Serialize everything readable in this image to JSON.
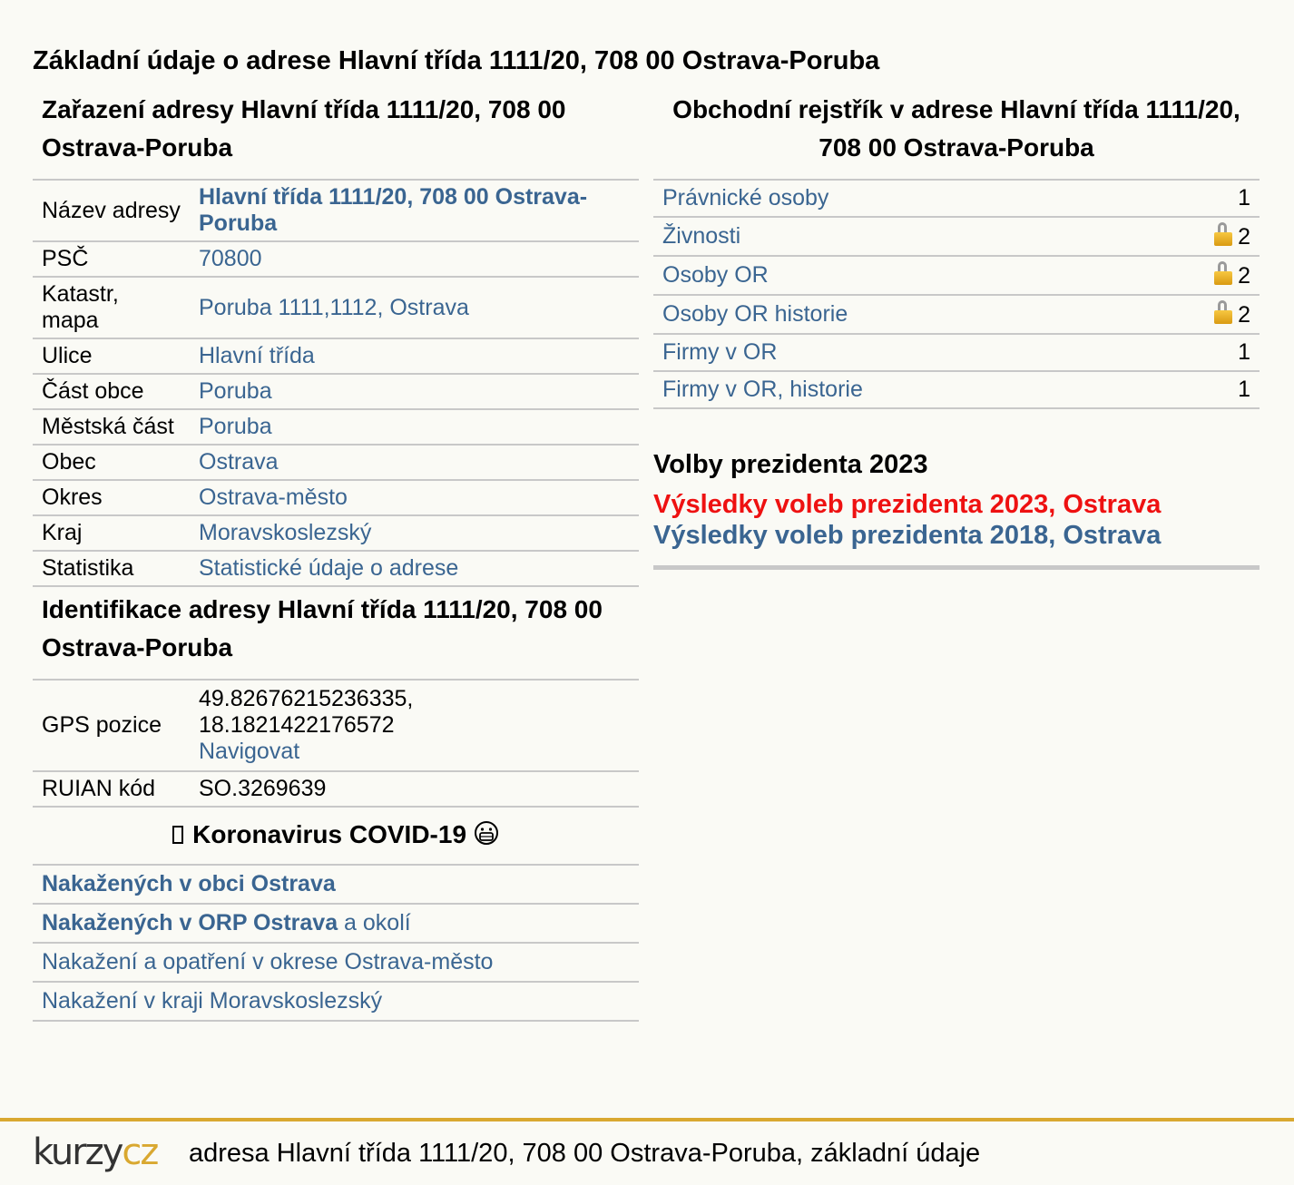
{
  "page_title": "Základní údaje o adrese Hlavní třída 1111/20, 708 00 Ostrava-Poruba",
  "zarazeni": {
    "title": "Zařazení adresy Hlavní třída 1111/20, 708 00 Ostrava-Poruba",
    "rows": [
      {
        "label": "Název adresy",
        "value": "Hlavní třída 1111/20, 708 00 Ostrava-Poruba"
      },
      {
        "label": "PSČ",
        "value": "70800"
      },
      {
        "label": "Katastr, mapa",
        "value": "Poruba 1111,1112, Ostrava"
      },
      {
        "label": "Ulice",
        "value": "Hlavní třída"
      },
      {
        "label": "Část obce",
        "value": "Poruba"
      },
      {
        "label": "Městská část",
        "value": "Poruba"
      },
      {
        "label": "Obec",
        "value": "Ostrava"
      },
      {
        "label": "Okres",
        "value": "Ostrava-město"
      },
      {
        "label": "Kraj",
        "value": "Moravskoslezský"
      },
      {
        "label": "Statistika",
        "value": "Statistické údaje o adrese"
      }
    ]
  },
  "identifikace": {
    "title": "Identifikace adresy Hlavní třída 1111/20, 708 00 Ostrava-Poruba",
    "gps_label": "GPS pozice",
    "gps_lat": "49.82676215236335,",
    "gps_lon": "18.1821422176572",
    "navigate": "Navigovat",
    "ruian_label": "RUIAN kód",
    "ruian_value": "SO.3269639"
  },
  "covid": {
    "title": "Koronavirus COVID-19",
    "rows": [
      {
        "link": "Nakažených v obci Ostrava",
        "suffix": ""
      },
      {
        "link": "Nakažených v ORP Ostrava",
        "suffix": " a okolí"
      },
      {
        "link": "Nakažení a opatření v okrese Ostrava-město",
        "suffix": ""
      },
      {
        "link": "Nakažení v kraji Moravskoslezský",
        "suffix": ""
      }
    ]
  },
  "rejstrik": {
    "title": "Obchodní rejstřík v adrese Hlavní třída 1111/20, 708 00 Ostrava-Poruba",
    "rows": [
      {
        "label": "Právnické osoby",
        "count": "1",
        "locked": false
      },
      {
        "label": "Živnosti",
        "count": "2",
        "locked": true
      },
      {
        "label": "Osoby OR",
        "count": "2",
        "locked": true
      },
      {
        "label": "Osoby OR historie",
        "count": "2",
        "locked": true
      },
      {
        "label": "Firmy v OR",
        "count": "1",
        "locked": false
      },
      {
        "label": "Firmy v OR, historie",
        "count": "1",
        "locked": false
      }
    ]
  },
  "volby": {
    "title": "Volby prezidenta 2023",
    "link_2023": "Výsledky voleb prezidenta 2023, Ostrava",
    "link_2018": "Výsledky voleb prezidenta 2018, Ostrava"
  },
  "footer": {
    "logo_kurzy": "kurzy",
    "logo_cz": "cz",
    "text": "adresa Hlavní třída 1111/20, 708 00 Ostrava-Poruba, základní údaje"
  },
  "colors": {
    "link": "#3a6591",
    "red_link": "#ee1111",
    "footer_accent": "#d9a830",
    "background": "#fafaf5"
  }
}
